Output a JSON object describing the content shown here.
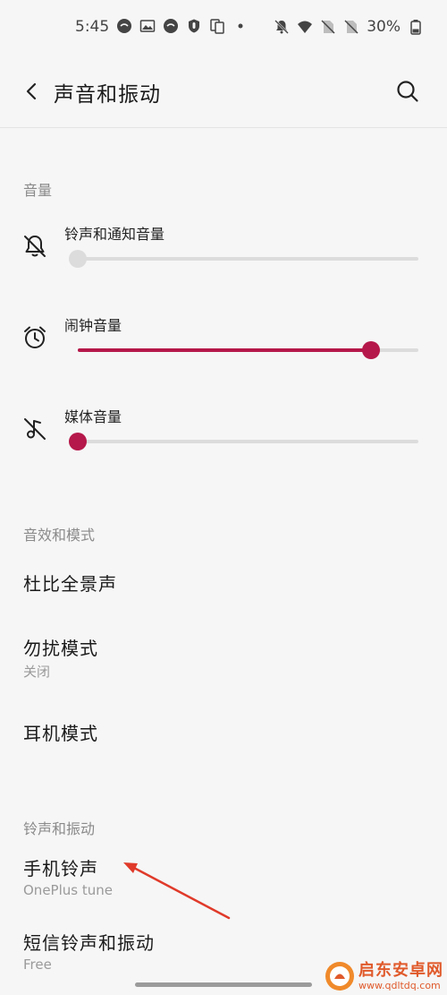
{
  "status_bar": {
    "time": "5:45",
    "battery": "30%",
    "left_icons": [
      "chat-bubble-icon",
      "image-icon",
      "chat-bubble-icon",
      "shield-icon",
      "copy-icon",
      "dot-icon"
    ],
    "right_icons": [
      "bell-off-icon",
      "wifi-icon",
      "no-sim-icon",
      "no-sim-icon",
      "battery-icon"
    ]
  },
  "header": {
    "title": "声音和振动",
    "back_icon": "back-arrow-icon",
    "search_icon": "search-icon"
  },
  "volume_section": {
    "header": "音量",
    "items": [
      {
        "label": "铃声和通知音量",
        "icon": "bell-off-icon",
        "level": 0.0,
        "active": false
      },
      {
        "label": "闹钟音量",
        "icon": "alarm-clock-icon",
        "level": 0.86,
        "active": true
      },
      {
        "label": "媒体音量",
        "icon": "music-off-icon",
        "level": 0.0,
        "active": true
      }
    ]
  },
  "effects_section": {
    "header": "音效和模式",
    "items": [
      {
        "title": "杜比全景声",
        "subtitle": ""
      },
      {
        "title": "勿扰模式",
        "subtitle": "关闭"
      },
      {
        "title": "耳机模式",
        "subtitle": ""
      }
    ]
  },
  "ringtone_section": {
    "header": "铃声和振动",
    "items": [
      {
        "title": "手机铃声",
        "subtitle": "OnePlus tune"
      },
      {
        "title": "短信铃声和振动",
        "subtitle": "Free"
      }
    ]
  },
  "watermark": {
    "name": "启东安卓网",
    "url": "www.qdltdq.com"
  },
  "colors": {
    "accent": "#b5184a",
    "track": "#dcdcdc",
    "background": "#f6f6f6",
    "annotation_arrow": "#e03a2a"
  }
}
